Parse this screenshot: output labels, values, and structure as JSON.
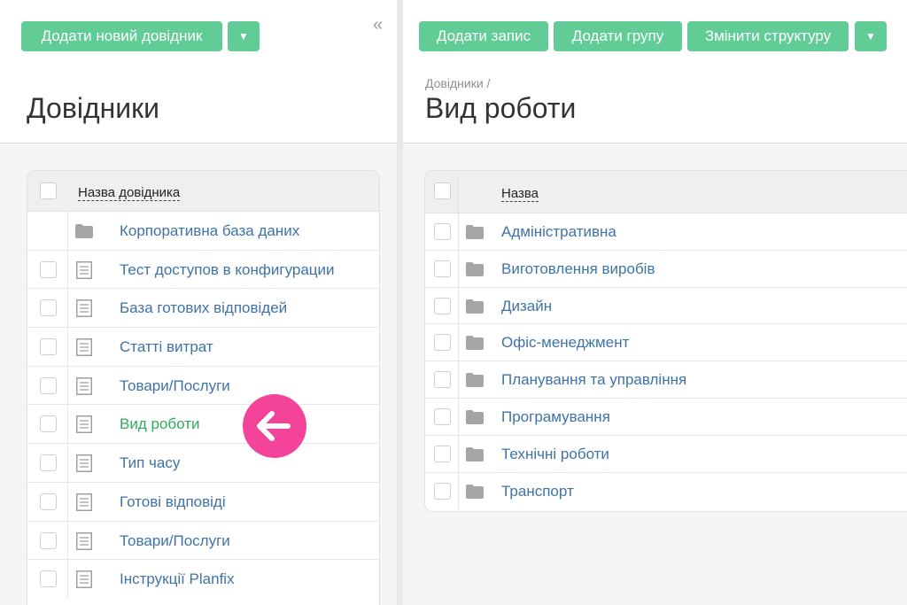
{
  "left": {
    "add_button": "Додати новий довідник",
    "caret": "▼",
    "collapse": "«",
    "title": "Довідники",
    "column_header": "Назва довідника",
    "items": [
      {
        "label": "Корпоративна база даних",
        "type": "folder",
        "checkbox": false,
        "active": false
      },
      {
        "label": "Тест доступов в конфигурации",
        "type": "doc",
        "checkbox": true,
        "active": false
      },
      {
        "label": "База готових відповідей",
        "type": "doc",
        "checkbox": true,
        "active": false
      },
      {
        "label": "Статті витрат",
        "type": "doc",
        "checkbox": true,
        "active": false
      },
      {
        "label": "Товари/Послуги",
        "type": "doc",
        "checkbox": true,
        "active": false
      },
      {
        "label": "Вид роботи",
        "type": "doc",
        "checkbox": true,
        "active": true
      },
      {
        "label": "Тип часу",
        "type": "doc",
        "checkbox": true,
        "active": false
      },
      {
        "label": "Готові відповіді",
        "type": "doc",
        "checkbox": true,
        "active": false
      },
      {
        "label": "Товари/Послуги",
        "type": "doc",
        "checkbox": true,
        "active": false
      },
      {
        "label": "Інструкції Planfix",
        "type": "doc",
        "checkbox": true,
        "active": false
      }
    ]
  },
  "right": {
    "add_record": "Додати запис",
    "add_group": "Додати групу",
    "change_structure": "Змінити структуру",
    "caret": "▼",
    "breadcrumb": "Довідники /",
    "title": "Вид роботи",
    "column_header": "Назва",
    "items": [
      "Адміністративна",
      "Виготовлення виробів",
      "Дизайн",
      "Офіс-менеджмент",
      "Планування та управління",
      "Програмування",
      "Технічні роботи",
      "Транспорт"
    ]
  },
  "icons": {
    "folder": "folder-icon",
    "doc": "document-icon",
    "pointer": "arrow-left-icon"
  },
  "colors": {
    "button": "#62cc96",
    "link": "#3f73a8",
    "active_link": "#2eaa5a",
    "pointer": "#f4449a"
  }
}
